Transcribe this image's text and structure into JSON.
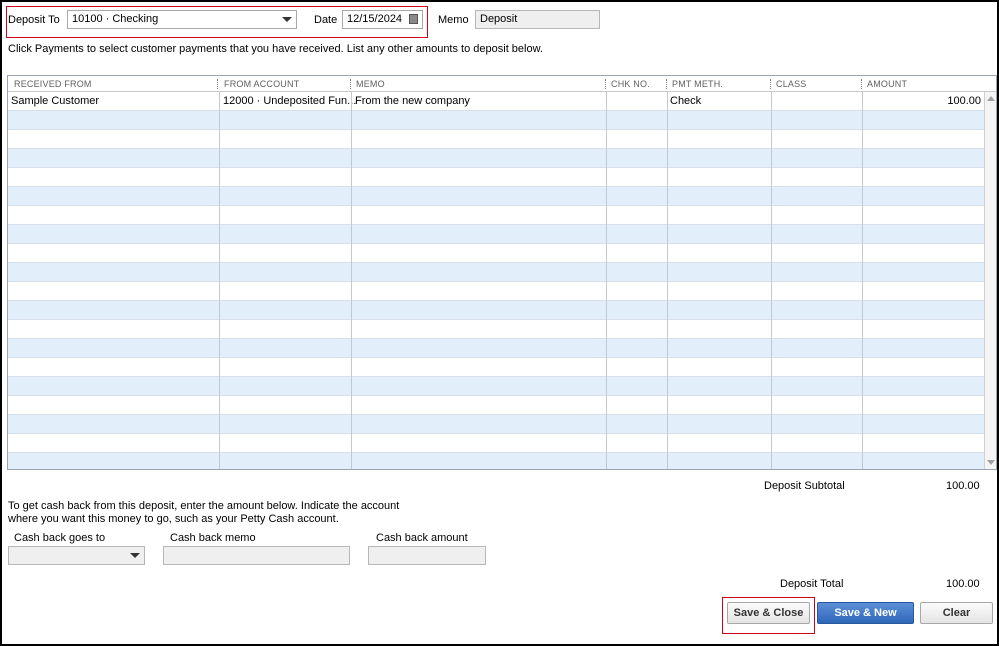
{
  "header": {
    "deposit_to_label": "Deposit To",
    "deposit_to_value": "10100 · Checking",
    "date_label": "Date",
    "date_value": "12/15/2024",
    "memo_label": "Memo",
    "memo_value": "Deposit"
  },
  "instructions": "Click Payments to select customer payments that you have received. List any other amounts to deposit below.",
  "grid": {
    "columns": [
      "RECEIVED FROM",
      "FROM ACCOUNT",
      "MEMO",
      "CHK NO.",
      "PMT METH.",
      "CLASS",
      "AMOUNT"
    ],
    "rows": [
      {
        "received_from": "Sample Customer",
        "from_account": "12000 · Undeposited Fun...",
        "memo": "From the new company",
        "chk_no": "",
        "pmt_meth": "Check",
        "class": "",
        "amount": "100.00"
      }
    ]
  },
  "totals": {
    "subtotal_label": "Deposit Subtotal",
    "subtotal_value": "100.00",
    "total_label": "Deposit Total",
    "total_value": "100.00"
  },
  "cash_back": {
    "instructions_line1": "To get cash back from this deposit, enter the amount below.  Indicate the account",
    "instructions_line2": "where you want this money to go, such as your Petty Cash account.",
    "goes_to_label": "Cash back goes to",
    "goes_to_value": "",
    "memo_label": "Cash back memo",
    "memo_value": "",
    "amount_label": "Cash back amount",
    "amount_value": ""
  },
  "buttons": {
    "save_close": "Save & Close",
    "save_new": "Save & New",
    "clear": "Clear"
  },
  "colors": {
    "highlight_box": "#d0021b",
    "row_alt": "#e3eefb",
    "primary_button": "#2f67b8"
  }
}
